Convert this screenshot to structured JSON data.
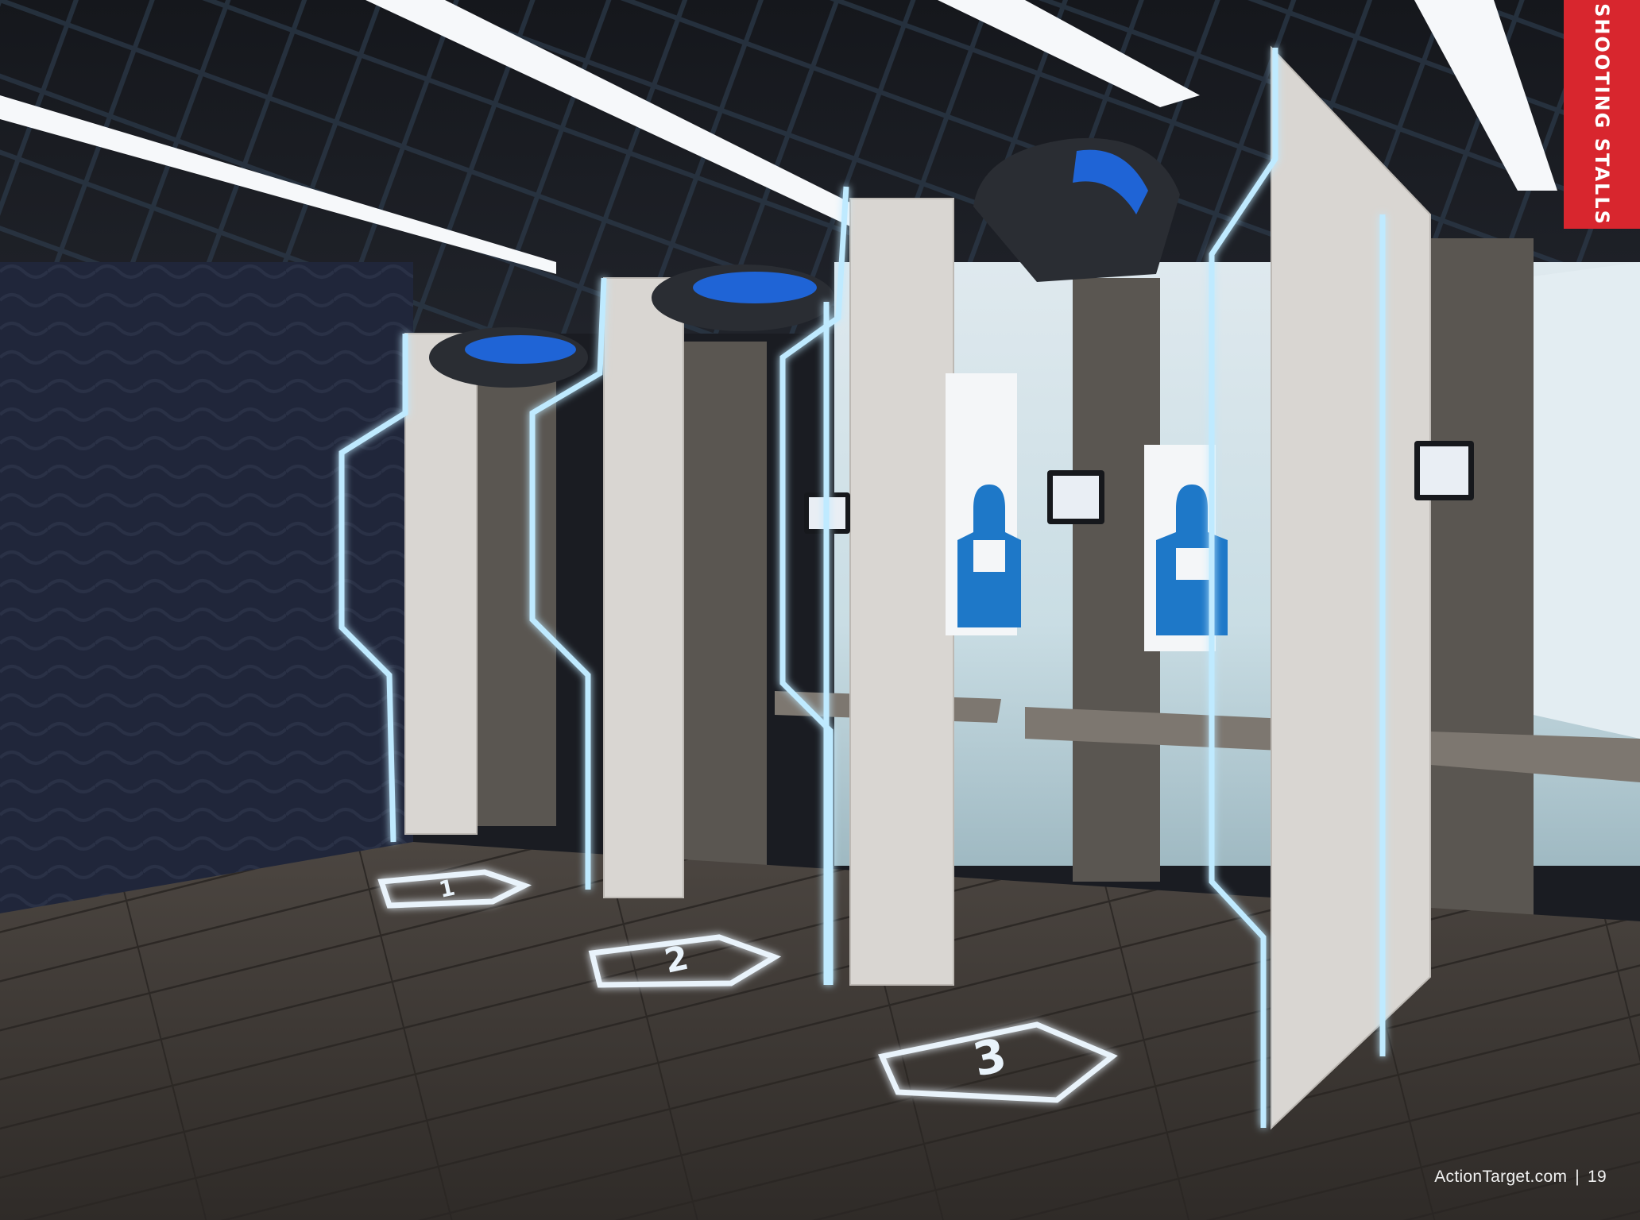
{
  "side_tab": {
    "label": "SHOOTING STALLS",
    "color": "#d8262e"
  },
  "footer": {
    "website": "ActionTarget.com",
    "separator": "|",
    "page_number": "19"
  },
  "floor_markers": [
    "1",
    "2",
    "3"
  ],
  "colors": {
    "accent_glow": "#58c8ff",
    "target_blue": "#1e78c8"
  }
}
